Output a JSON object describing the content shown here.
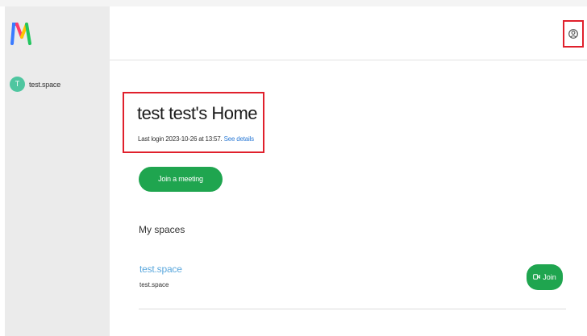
{
  "sidebar": {
    "space": {
      "initial": "T",
      "name": "test.space"
    }
  },
  "main": {
    "title": "test test's Home",
    "last_login": "Last login 2023-10-26 at 13:57.",
    "see_details": "See details",
    "join_meeting_label": "Join a meeting",
    "my_spaces_heading": "My spaces",
    "spaces": [
      {
        "name": "test.space",
        "subtitle": "test.space",
        "join_label": "Join"
      }
    ]
  },
  "colors": {
    "accent_green": "#1fa54f",
    "link_blue": "#2d7bd6",
    "highlight_red": "#e0202c",
    "avatar_teal": "#4fc6a0"
  },
  "icons": {
    "logo": "m-logo-icon",
    "profile": "user-circle-icon",
    "join": "video-camera-icon"
  }
}
